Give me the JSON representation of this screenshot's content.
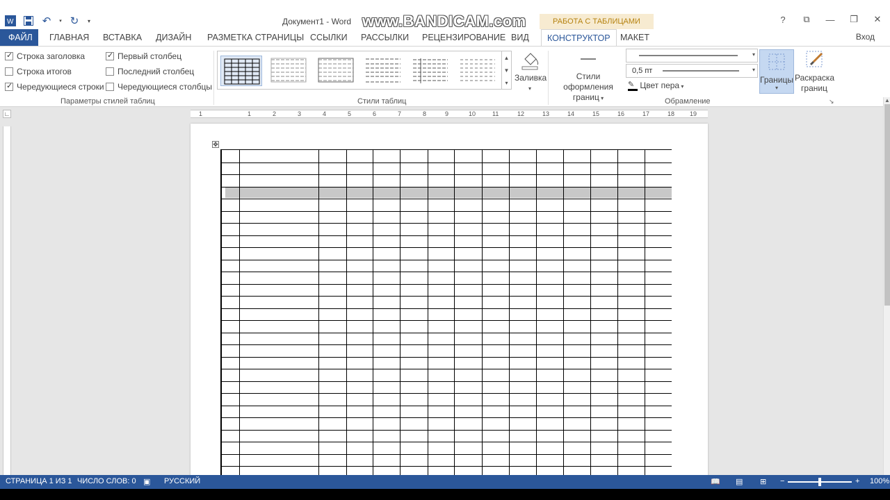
{
  "window": {
    "doc_title": "Документ1 - Word",
    "watermark": "www.BANDICAM.com",
    "context_tab": "РАБОТА С ТАБЛИЦАМИ",
    "help": "?",
    "login": "Вход"
  },
  "tabs": [
    "ФАЙЛ",
    "ГЛАВНАЯ",
    "ВСТАВКА",
    "ДИЗАЙН",
    "РАЗМЕТКА СТРАНИЦЫ",
    "ССЫЛКИ",
    "РАССЫЛКИ",
    "РЕЦЕНЗИРОВАНИЕ",
    "ВИД",
    "КОНСТРУКТОР",
    "МАКЕТ"
  ],
  "style_options": {
    "header_row": "Строка заголовка",
    "total_row": "Строка итогов",
    "banded_rows": "Чередующиеся строки",
    "first_column": "Первый столбец",
    "last_column": "Последний столбец",
    "banded_columns": "Чередующиеся столбцы",
    "group_label": "Параметры стилей таблиц"
  },
  "table_styles": {
    "group_label": "Стили таблиц",
    "shading": "Заливка"
  },
  "borders": {
    "border_styles_l1": "Стили оформления",
    "border_styles_l2": "границ",
    "pen_weight": "0,5 пт",
    "pen_color": "Цвет пера",
    "borders_btn": "Границы",
    "painter_l1": "Раскраска",
    "painter_l2": "границ",
    "group_label": "Обрамление"
  },
  "ruler_numbers": [
    "1",
    "1",
    "2",
    "3",
    "4",
    "5",
    "6",
    "7",
    "8",
    "9",
    "10",
    "11",
    "12",
    "13",
    "14",
    "15",
    "16",
    "17",
    "18",
    "19"
  ],
  "status": {
    "page": "СТРАНИЦА 1 ИЗ 1",
    "words": "ЧИСЛО СЛОВ: 0",
    "language": "РУССКИЙ",
    "zoom": "100%"
  },
  "colors": {
    "accent": "#2b579a",
    "context": "#f7ebd1"
  }
}
